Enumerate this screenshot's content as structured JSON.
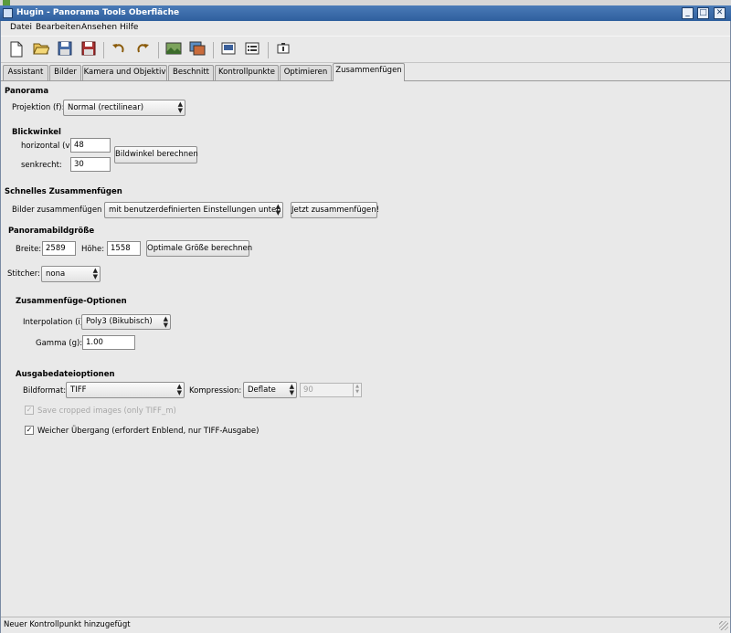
{
  "title_bar": {
    "title": "Hugin - Panorama Tools Oberfläche",
    "minimize": "_",
    "maximize": "□",
    "close": "✕"
  },
  "menu": {
    "items": [
      "Datei",
      "Bearbeiten",
      "Ansehen",
      "Hilfe"
    ]
  },
  "toolbar_icons": [
    "new-icon",
    "open-icon",
    "save-icon",
    "save-as-icon",
    "undo-icon",
    "redo-icon",
    "open-image-icon",
    "add-images-icon",
    "preview-icon",
    "list-icon",
    "info-icon"
  ],
  "tabs": {
    "items": [
      "Assistant",
      "Bilder",
      "Kamera und Objektiv",
      "Beschnitt",
      "Kontrollpunkte",
      "Optimieren",
      "Zusammenfügen"
    ],
    "active": "Zusammenfügen"
  },
  "panorama": {
    "header": "Panorama",
    "projection_label": "Projektion (f):",
    "projection_value": "Normal (rectilinear)",
    "fov_header": "Blickwinkel",
    "horizontal_label": "horizontal (v):",
    "horizontal_value": "48",
    "vertical_label": "senkrecht:",
    "vertical_value": "30",
    "calc_fov_button": "Bildwinkel berechnen"
  },
  "quick_stitch": {
    "header": "Schnelles Zusammenfügen",
    "stitch_label": "Bilder zusammenfügen",
    "stitch_mode": "mit benutzerdefinierten Einstellungen unten",
    "stitch_now_button": "Jetzt zusammenfügen!"
  },
  "canvas_size": {
    "header": "Panoramabildgröße",
    "width_label": "Breite:",
    "width_value": "2589",
    "height_label": "Höhe:",
    "height_value": "1558",
    "optimal_button": "Optimale Größe berechnen"
  },
  "stitcher": {
    "label": "Stitcher:",
    "value": "nona"
  },
  "stitch_options": {
    "header": "Zusammenfüge-Optionen",
    "interpolation_label": "Interpolation (i):",
    "interpolation_value": "Poly3 (Bikubisch)",
    "gamma_label": "Gamma (g):",
    "gamma_value": "1.00"
  },
  "output_options": {
    "header": "Ausgabedateioptionen",
    "format_label": "Bildformat:",
    "format_value": "TIFF",
    "compression_label": "Kompression:",
    "compression_value": "Deflate",
    "quality_value": "90",
    "save_cropped_label": "Save cropped images (only TIFF_m)",
    "save_cropped_checked": true,
    "soft_blend_label": "Weicher Übergang (erfordert Enblend, nur TIFF-Ausgabe)",
    "soft_blend_checked": true
  },
  "status": {
    "text": "Neuer Kontrollpunkt hinzugefügt"
  }
}
